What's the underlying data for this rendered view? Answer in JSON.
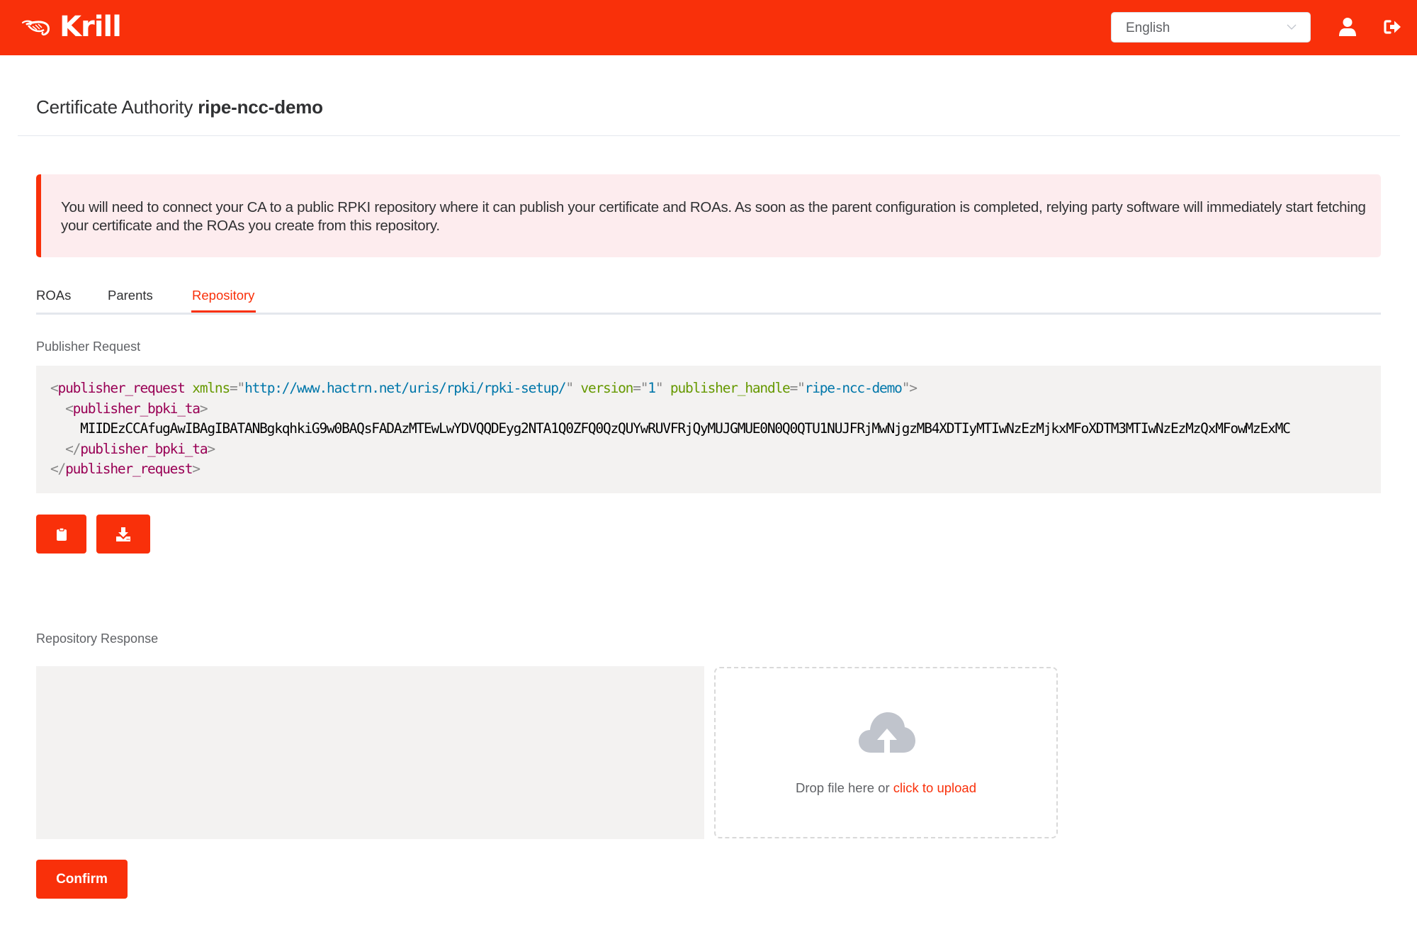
{
  "header": {
    "brand": "Krill",
    "language_select": {
      "value": "English"
    },
    "icons": {
      "user": "user-icon",
      "logout": "sign-out-icon"
    },
    "brand_color": "#f9300a"
  },
  "page": {
    "title_prefix": "Certificate Authority",
    "ca_name": "ripe-ncc-demo"
  },
  "alert": {
    "text": "You will need to connect your CA to a public RPKI repository where it can publish your certificate and ROAs. As soon as the parent configuration is completed, relying party software will immediately start fetching your certificate and the ROAs you create from this repository."
  },
  "tabs": [
    {
      "label": "ROAs",
      "active": false
    },
    {
      "label": "Parents",
      "active": false
    },
    {
      "label": "Repository",
      "active": true
    }
  ],
  "publisher_request": {
    "label": "Publisher Request",
    "xml": {
      "root_tag": "publisher_request",
      "xmlns_attr": "xmlns",
      "xmlns_value": "http://www.hactrn.net/uris/rpki/rpki-setup/",
      "version_attr": "version",
      "version_value": "1",
      "handle_attr": "publisher_handle",
      "handle_value": "ripe-ncc-demo",
      "child_tag": "publisher_bpki_ta",
      "ta_content": "MIIDEzCCAfugAwIBAgIBATANBgkqhkiG9w0BAQsFADAzMTEwLwYDVQQDEyg2NTA1Q0ZFQ0QzQUYwRUVFRjQyMUJGMUE0N0Q0QTU1NUJFRjMwNjgzMB4XDTIyMTIwNzEzMjkxMFoXDTM3MTIwNzEzMzQxMFowMzExMC"
    },
    "buttons": {
      "copy": "clipboard-icon",
      "download": "download-icon"
    }
  },
  "repository_response": {
    "label": "Repository Response",
    "textarea_value": "",
    "dropzone": {
      "text": "Drop file here or",
      "link": "click to upload",
      "icon": "cloud-upload-icon"
    },
    "confirm_label": "Confirm"
  }
}
